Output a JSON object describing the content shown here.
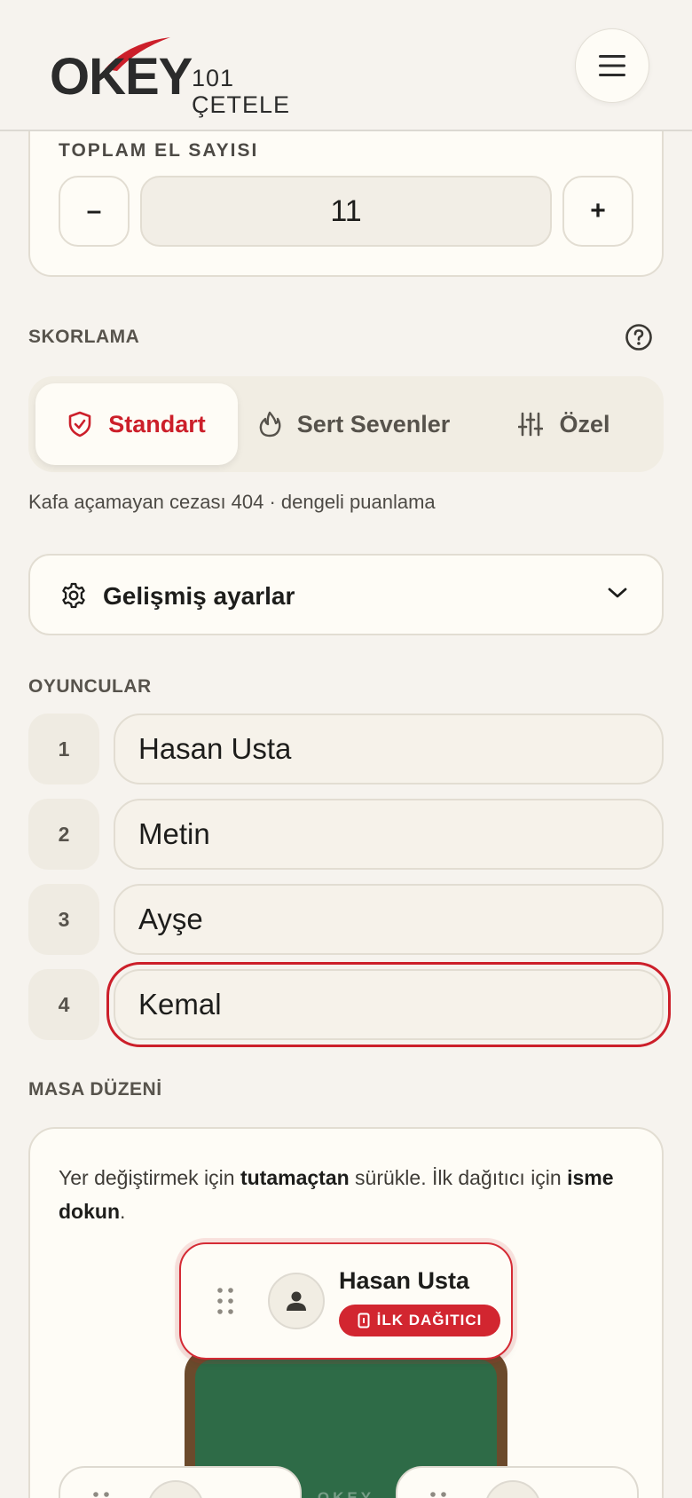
{
  "header": {
    "logo_main": "OKEY",
    "logo_sub": "101 ÇETELE",
    "menu_icon": "hamburger-menu-icon"
  },
  "hand_count": {
    "label": "TOPLAM EL SAYISI",
    "minus": "–",
    "value": "11",
    "plus": "+"
  },
  "scoring": {
    "label": "SKORLAMA",
    "help_icon": "question-circle-icon",
    "options": [
      {
        "label": "Standart",
        "icon": "shield-icon",
        "active": true
      },
      {
        "label": "Sert Sevenler",
        "icon": "flame-icon",
        "active": false
      },
      {
        "label": "Özel",
        "icon": "sliders-icon",
        "active": false
      }
    ],
    "description": "Kafa açamayan cezası 404 · dengeli puanlama"
  },
  "advanced": {
    "label": "Gelişmiş ayarlar",
    "icon": "gear-icon",
    "chevron": "chevron-down-icon"
  },
  "players": {
    "label": "OYUNCULAR",
    "items": [
      {
        "number": "1",
        "name": "Hasan Usta"
      },
      {
        "number": "2",
        "name": "Metin"
      },
      {
        "number": "3",
        "name": "Ayşe"
      },
      {
        "number": "4",
        "name": "Kemal"
      }
    ]
  },
  "table": {
    "label": "MASA DÜZENİ",
    "instruction_1": "Yer değiştirmek için ",
    "instruction_bold_1": "tutamaçtan",
    "instruction_2": " sürükle. İlk dağıtıcı için ",
    "instruction_bold_2": "isme dokun",
    "instruction_3": ".",
    "felt_text": "OKEY",
    "top_seat": {
      "name": "Hasan Usta",
      "badge": "İLK DAĞITICI"
    }
  },
  "colors": {
    "accent": "#cc1f2a",
    "background": "#f6f3ee",
    "card": "#fefcf6",
    "felt": "#2e6b47",
    "table_wood": "#6b4a2c"
  }
}
